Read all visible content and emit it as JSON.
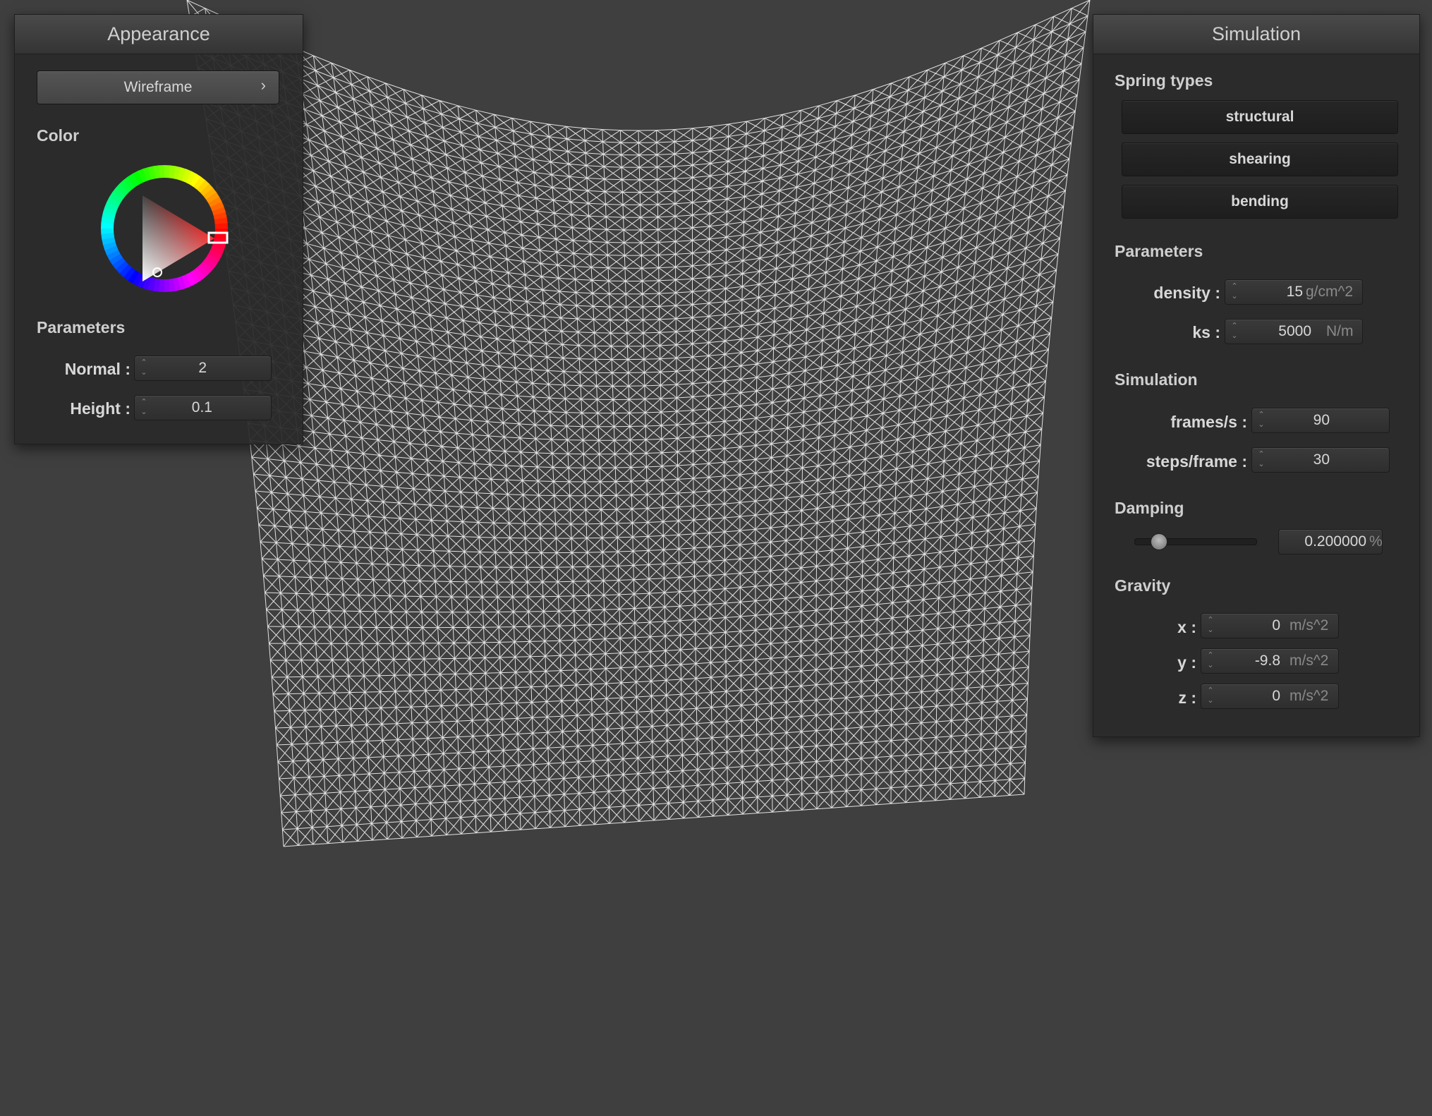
{
  "appearance_panel": {
    "title": "Appearance",
    "shader_button": {
      "label": "Wireframe",
      "chevron": "›"
    },
    "color_section": {
      "label": "Color",
      "selected_color": "#ff0000",
      "wheel_icon": "color-wheel-icon"
    },
    "parameters_section": {
      "label": "Parameters",
      "normal": {
        "label": "Normal :",
        "value": "2"
      },
      "height": {
        "label": "Height :",
        "value": "0.1"
      }
    }
  },
  "simulation_panel": {
    "title": "Simulation",
    "spring_types": {
      "label": "Spring types",
      "buttons": [
        "structural",
        "shearing",
        "bending"
      ]
    },
    "parameters": {
      "label": "Parameters",
      "density": {
        "label": "density :",
        "value": "15",
        "unit": "g/cm^2"
      },
      "ks": {
        "label": "ks :",
        "value": "5000",
        "unit": "N/m"
      }
    },
    "simulation": {
      "label": "Simulation",
      "frames_per_s": {
        "label": "frames/s :",
        "value": "90"
      },
      "steps_per_frame": {
        "label": "steps/frame :",
        "value": "30"
      }
    },
    "damping": {
      "label": "Damping",
      "slider_fraction": 0.2,
      "value": "0.200000",
      "unit": "%"
    },
    "gravity": {
      "label": "Gravity",
      "x": {
        "label": "x :",
        "value": "0",
        "unit": "m/s^2"
      },
      "y": {
        "label": "y :",
        "value": "-9.8",
        "unit": "m/s^2"
      },
      "z": {
        "label": "z :",
        "value": "0",
        "unit": "m/s^2"
      }
    }
  },
  "colors": {
    "background": "#3f3f3f",
    "wireframe": "#ffffff",
    "panel": "#2a2a2a"
  },
  "icons": {
    "spin_arrows": "spin-arrows-icon",
    "chevron": "chevron-right-icon"
  }
}
